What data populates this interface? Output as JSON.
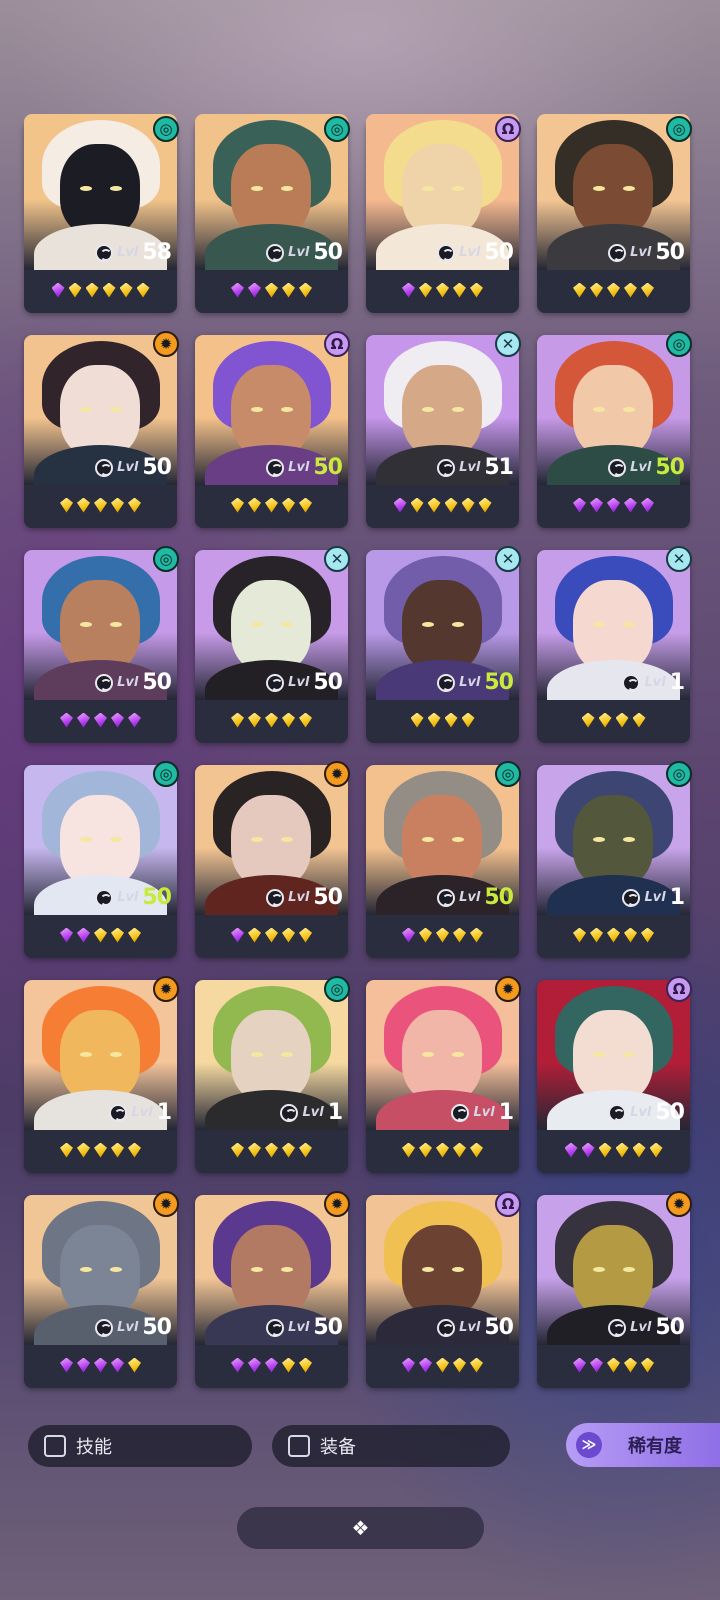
{
  "heroes": [
    {
      "level": "58",
      "max": false,
      "gems": [
        "p",
        "g",
        "g",
        "g",
        "g",
        "g"
      ],
      "badge": "swirl",
      "colors": [
        "#f2c48a",
        "#f4efe9",
        "#1c1c24",
        "#e8e2da"
      ]
    },
    {
      "level": "50",
      "max": false,
      "gems": [
        "p",
        "p",
        "g",
        "g",
        "g"
      ],
      "badge": "swirl",
      "colors": [
        "#f1c28a",
        "#2f5c55",
        "#b97c57",
        "#38584f"
      ]
    },
    {
      "level": "50",
      "max": false,
      "gems": [
        "p",
        "g",
        "g",
        "g",
        "g"
      ],
      "badge": "omega",
      "colors": [
        "#f5b990",
        "#f3dd8e",
        "#efd3a9",
        "#f3e7d7"
      ]
    },
    {
      "level": "50",
      "max": false,
      "gems": [
        "g",
        "g",
        "g",
        "g",
        "g"
      ],
      "badge": "swirl",
      "colors": [
        "#f3c592",
        "#2a2622",
        "#7b4b33",
        "#3b3a3f"
      ]
    },
    {
      "level": "50",
      "max": false,
      "gems": [
        "g",
        "g",
        "g",
        "g",
        "g"
      ],
      "badge": "sun",
      "colors": [
        "#f2c38e",
        "#261b26",
        "#f0ded6",
        "#263242"
      ]
    },
    {
      "level": "50",
      "max": true,
      "gems": [
        "g",
        "g",
        "g",
        "g",
        "g"
      ],
      "badge": "omega",
      "colors": [
        "#f4c18a",
        "#7a4ed6",
        "#c88b6a",
        "#6a3e84"
      ]
    },
    {
      "level": "51",
      "max": false,
      "gems": [
        "p",
        "g",
        "g",
        "g",
        "g",
        "g"
      ],
      "badge": "cross",
      "colors": [
        "#c596ea",
        "#f1f0f2",
        "#d5a988",
        "#303036"
      ]
    },
    {
      "level": "50",
      "max": true,
      "gems": [
        "p",
        "p",
        "p",
        "p",
        "p"
      ],
      "badge": "swirl",
      "colors": [
        "#c79ae8",
        "#d5532f",
        "#f1c9a9",
        "#2d4c45"
      ]
    },
    {
      "level": "50",
      "max": false,
      "gems": [
        "p",
        "p",
        "p",
        "p",
        "p"
      ],
      "badge": "swirl",
      "colors": [
        "#c59ae8",
        "#2c6da8",
        "#b8805f",
        "#5e3c5c"
      ]
    },
    {
      "level": "50",
      "max": false,
      "gems": [
        "g",
        "g",
        "g",
        "g",
        "g"
      ],
      "badge": "cross",
      "colors": [
        "#c79be8",
        "#1f1c1f",
        "#e4e9d8",
        "#222025"
      ]
    },
    {
      "level": "50",
      "max": true,
      "gems": [
        "g",
        "g",
        "g",
        "g"
      ],
      "badge": "cross",
      "colors": [
        "#b899e7",
        "#6d5aa6",
        "#54372e",
        "#4a3977"
      ]
    },
    {
      "level": "1",
      "max": false,
      "gems": [
        "g",
        "g",
        "g",
        "g"
      ],
      "badge": "cross",
      "colors": [
        "#c69de9",
        "#3347b8",
        "#f5d8cf",
        "#e6e7ee"
      ]
    },
    {
      "level": "50",
      "max": true,
      "gems": [
        "p",
        "p",
        "g",
        "g",
        "g"
      ],
      "badge": "swirl",
      "colors": [
        "#c6b7ee",
        "#9fb5d6",
        "#f7e3e0",
        "#e2e7f2"
      ]
    },
    {
      "level": "50",
      "max": false,
      "gems": [
        "p",
        "g",
        "g",
        "g",
        "g"
      ],
      "badge": "sun",
      "colors": [
        "#f2c492",
        "#1e1a1d",
        "#e6c9be",
        "#612520"
      ]
    },
    {
      "level": "50",
      "max": true,
      "gems": [
        "p",
        "g",
        "g",
        "g",
        "g"
      ],
      "badge": "swirl",
      "colors": [
        "#f3c18e",
        "#8e8a86",
        "#c88060",
        "#2b2327"
      ]
    },
    {
      "level": "1",
      "max": false,
      "gems": [
        "g",
        "g",
        "g",
        "g",
        "g"
      ],
      "badge": "swirl",
      "colors": [
        "#c8a5ea",
        "#36406d",
        "#53573b",
        "#203050"
      ]
    },
    {
      "level": "1",
      "max": false,
      "gems": [
        "g",
        "g",
        "g",
        "g",
        "g"
      ],
      "badge": "sun",
      "colors": [
        "#f4c49a",
        "#f47a2e",
        "#f0b75c",
        "#e6e2de"
      ]
    },
    {
      "level": "1",
      "max": false,
      "gems": [
        "g",
        "g",
        "g",
        "g",
        "g"
      ],
      "badge": "swirl",
      "colors": [
        "#f6d9a0",
        "#8cb64c",
        "#e5d2c0",
        "#2b2b2e"
      ]
    },
    {
      "level": "1",
      "max": false,
      "gems": [
        "g",
        "g",
        "g",
        "g",
        "g"
      ],
      "badge": "sun",
      "colors": [
        "#f4bf9a",
        "#e94e7a",
        "#f1b6a8",
        "#c64e65"
      ]
    },
    {
      "level": "50",
      "max": false,
      "gems": [
        "p",
        "p",
        "g",
        "g",
        "g",
        "g"
      ],
      "badge": "omega",
      "colors": [
        "#b21e38",
        "#2c6a63",
        "#f3ddd3",
        "#e8ebef"
      ]
    },
    {
      "level": "50",
      "max": false,
      "gems": [
        "p",
        "p",
        "p",
        "p",
        "g"
      ],
      "badge": "sun",
      "colors": [
        "#f1c696",
        "#667183",
        "#7c8595",
        "#59606d"
      ]
    },
    {
      "level": "50",
      "max": false,
      "gems": [
        "p",
        "p",
        "p",
        "g",
        "g"
      ],
      "badge": "sun",
      "colors": [
        "#f3c695",
        "#52318d",
        "#b37a63",
        "#393854"
      ]
    },
    {
      "level": "50",
      "max": false,
      "gems": [
        "p",
        "p",
        "g",
        "g",
        "g"
      ],
      "badge": "omega",
      "colors": [
        "#f2c495",
        "#f0c04e",
        "#6c4232",
        "#2c2a3a"
      ]
    },
    {
      "level": "50",
      "max": false,
      "gems": [
        "p",
        "p",
        "g",
        "g",
        "g"
      ],
      "badge": "sun",
      "colors": [
        "#c7a1ea",
        "#2f2d35",
        "#b59a44",
        "#1f1f25"
      ]
    }
  ],
  "level_prefix": "Lvl",
  "filters": {
    "skill_label": "技能",
    "equipment_label": "装备",
    "sort_label": "稀有度"
  },
  "badge_icons": {
    "sun": "✹",
    "swirl": "◎",
    "cross": "✕",
    "omega": "Ω"
  },
  "bottom_icon": "❖"
}
